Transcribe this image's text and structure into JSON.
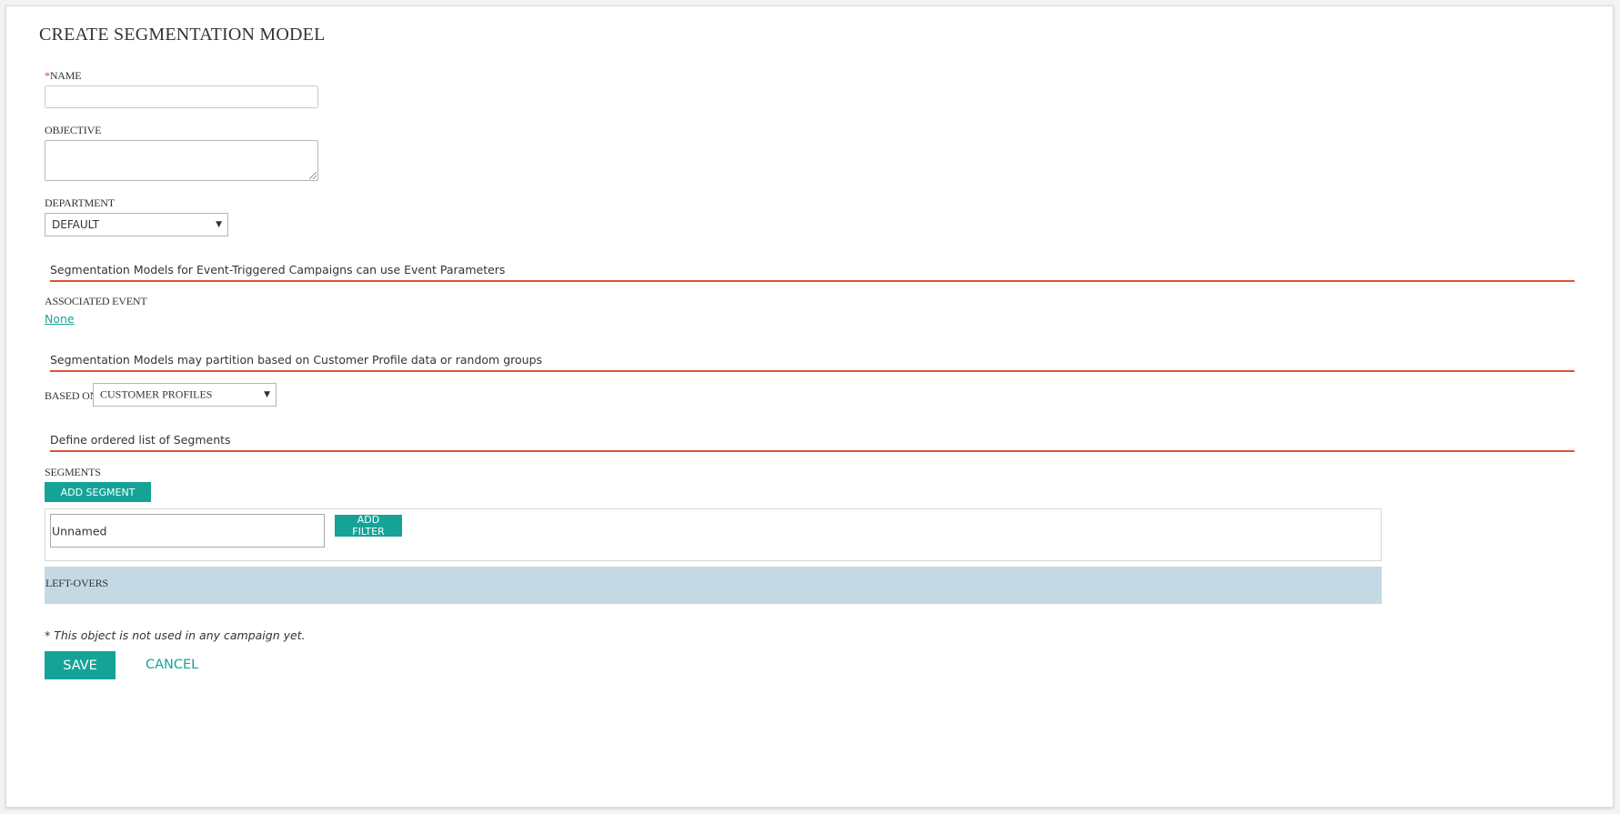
{
  "page": {
    "title": "CREATE SEGMENTATION MODEL"
  },
  "form": {
    "name": {
      "required_mark": "*",
      "label": "NAME",
      "value": ""
    },
    "objective": {
      "label": "OBJECTIVE",
      "value": ""
    },
    "department": {
      "label": "DEPARTMENT",
      "selected": "DEFAULT"
    }
  },
  "sections": {
    "event": {
      "heading": "Segmentation Models for Event-Triggered Campaigns can use Event Parameters",
      "associated_event_label": "ASSOCIATED EVENT",
      "associated_event_value": "None"
    },
    "partition": {
      "heading": "Segmentation Models may partition based on Customer Profile data or random groups",
      "based_on_label": "BASED ON",
      "based_on_selected": "CUSTOMER PROFILES"
    },
    "segments": {
      "heading": "Define ordered list of Segments",
      "label": "SEGMENTS",
      "add_segment_label": "ADD SEGMENT",
      "items": [
        {
          "name": "Unnamed",
          "add_filter_label": "ADD FILTER"
        }
      ],
      "leftovers_label": "LEFT-OVERS"
    }
  },
  "footer": {
    "note": "* This object is not used in any campaign yet.",
    "save_label": "SAVE",
    "cancel_label": "CANCEL"
  },
  "colors": {
    "accent": "#15a398",
    "section_rule": "#e0522e",
    "leftovers_bg": "#c4d9e4",
    "required": "#d9412a"
  },
  "icons": {
    "select_arrow": "caret-down-icon",
    "resize_grip": "resize-grip-icon"
  }
}
